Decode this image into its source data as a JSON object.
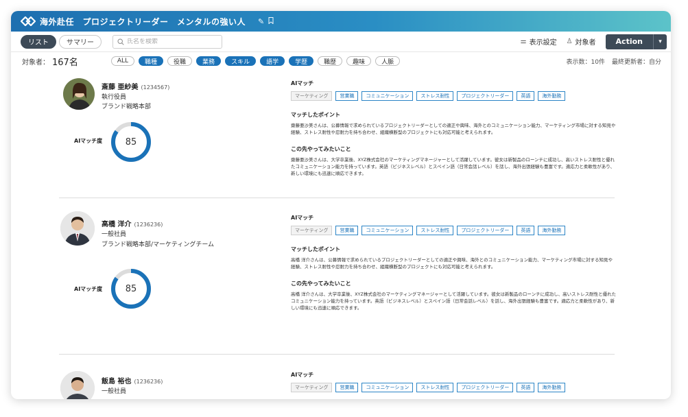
{
  "header": {
    "title": "海外赴任　プロジェクトリーダー　メンタルの強い人",
    "edit_icon": "pencil-icon",
    "bookmark_icon": "bookmark-icon"
  },
  "toolbar": {
    "view_list": "リスト",
    "view_summary": "サマリー",
    "search_placeholder": "氏名を検索",
    "display_settings": "表示設定",
    "targets": "対象者",
    "action": "Action"
  },
  "filter": {
    "count_label": "対象者：",
    "count_value": "167名",
    "chips": [
      {
        "label": "ALL",
        "on": false
      },
      {
        "label": "職種",
        "on": true
      },
      {
        "label": "役職",
        "on": false
      },
      {
        "label": "業務",
        "on": true
      },
      {
        "label": "スキル",
        "on": true
      },
      {
        "label": "語学",
        "on": true
      },
      {
        "label": "学歴",
        "on": true
      },
      {
        "label": "職歴",
        "on": false
      },
      {
        "label": "趣味",
        "on": false
      },
      {
        "label": "人脈",
        "on": false
      }
    ],
    "per_page": "表示数：10件",
    "last_updated": "最終更新者：自分"
  },
  "colors": {
    "header_start": "#1e6fb0",
    "header_end": "#5cc3c9",
    "chip_on": "#1a72b8",
    "action_bg": "#3d4a57",
    "gauge_fill": "#1a72b8",
    "gauge_track": "#dcdcdc"
  },
  "labels": {
    "ai_match": "AIマッチ",
    "match_points": "マッチしたポイント",
    "want_to_do": "この先やってみたいこと",
    "ai_match_score": "AIマッチ度"
  },
  "people": [
    {
      "name": "斎藤 亜紗美",
      "id": "(1234567)",
      "role": "執行役員",
      "dept": "ブランド戦略本部",
      "score": "85",
      "score_fraction": 0.85,
      "tags": [
        "マーケティング",
        "営業職",
        "コミュニケーション",
        "ストレス耐性",
        "プロジェクトリーダー",
        "英語",
        "海外勤務"
      ],
      "points": "齋藤亜沙美さんは、公募情報で求められているプロジェクトリーダーとしての適正や興味、海外とのコミュニケーション能力、マーケティング市場に対する知見や経験、ストレス耐性や忍耐力を持ち合わせ、組織横断型のプロジェクトにも対応可能と考えられます。",
      "future": "齋藤亜沙美さんは、大学卒業後、XYZ株式会社のマーケティングマネージャーとして活躍しています。彼女は新製品のローンチに成功し、高いストレス耐性と優れたコミュニケーション能力を持っています。英語（ビジネスレベル）とスペイン語（日常会話レベル）を話し、海外出張経験も豊富です。適応力と柔軟性があり、新しい環境にも迅速に順応できます。"
    },
    {
      "name": "高橋 洋介",
      "id": "(1236236)",
      "role": "一般社員",
      "dept": "ブランド戦略本部/マーケティングチーム",
      "score": "85",
      "score_fraction": 0.85,
      "tags": [
        "マーケティング",
        "営業職",
        "コミュニケーション",
        "ストレス耐性",
        "プロジェクトリーダー",
        "英語",
        "海外勤務"
      ],
      "points": "高橋 洋介さんは、公募情報で求められているプロジェクトリーダーとしての適正や興味、海外とのコミュニケーション能力、マーケティング市場に対する知見や経験、ストレス耐性や忍耐力を持ち合わせ、組織横断型のプロジェクトにも対応可能と考えられます。",
      "future": "高橋 洋介さんは、大学卒業後、XYZ株式会社のマーケティングマネージャーとして活躍しています。彼女は新製品のローンチに成功し、高いストレス耐性と優れたコミュニケーション能力を持っています。英語（ビジネスレベル）とスペイン語（日常会話レベル）を話し、海外出張経験も豊富です。適応力と柔軟性があり、新しい環境にも迅速に順応できます。"
    },
    {
      "name": "飯島 裕也",
      "id": "(1236236)",
      "role": "一般社員",
      "tags": [
        "マーケティング",
        "営業職",
        "コミュニケーション",
        "ストレス耐性",
        "プロジェクトリーダー",
        "英語",
        "海外勤務"
      ]
    }
  ]
}
